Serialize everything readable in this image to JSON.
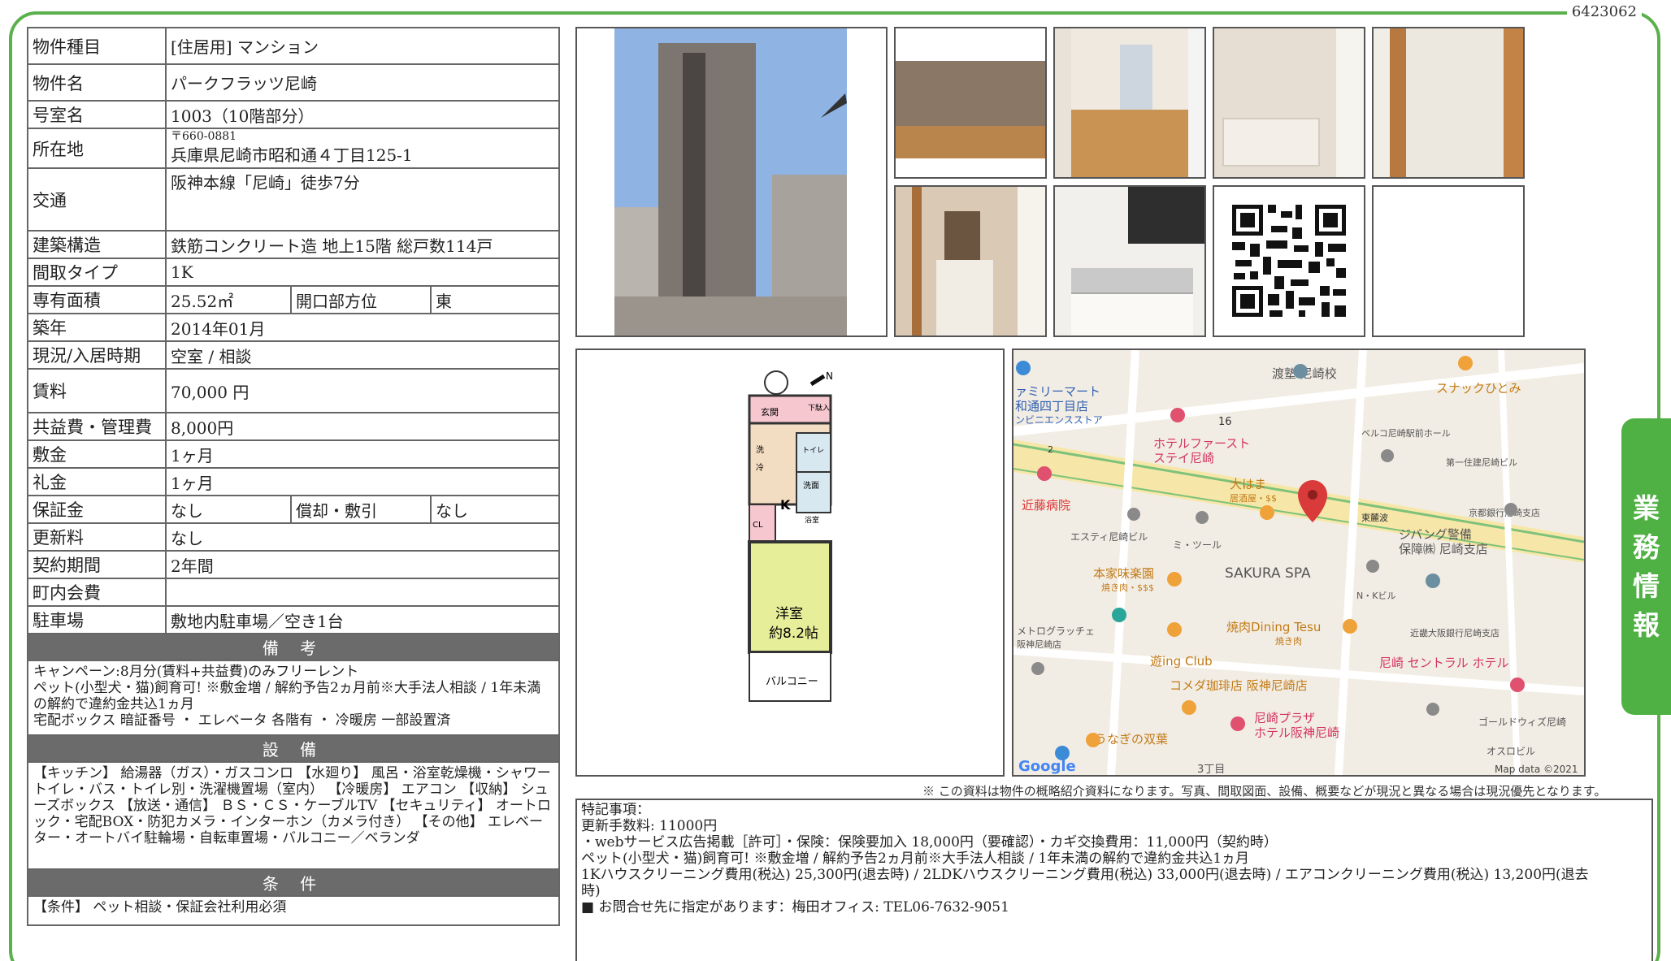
{
  "page": {
    "property_id": "6423062",
    "side_tab": [
      "業",
      "務",
      "情",
      "報"
    ]
  },
  "spec": {
    "type_label": "物件種目",
    "type_value": "[住居用] マンション",
    "name_label": "物件名",
    "name_value": "パークフラッツ尼崎",
    "room_label": "号室名",
    "room_value": "1003（10階部分）",
    "address_label": "所在地",
    "postal": "〒660-0881",
    "address": "兵庫県尼崎市昭和通４丁目125-1",
    "transit_label": "交通",
    "transit_value": "阪神本線「尼崎」徒歩7分",
    "structure_label": "建築構造",
    "structure_value": "鉄筋コンクリート造 地上15階 総戸数114戸",
    "layout_label": "間取タイプ",
    "layout_value": "1K",
    "area_label": "専有面積",
    "area_value": "25.52㎡",
    "direction_label": "開口部方位",
    "direction_value": "東",
    "built_label": "築年",
    "built_value": "2014年01月",
    "status_label": "現況/入居時期",
    "status_value": "空室 / 相談",
    "rent_label": "賃料",
    "rent_value": "70,000 円",
    "fee_label": "共益費・管理費",
    "fee_value": "8,000円",
    "deposit_label": "敷金",
    "deposit_value": "1ヶ月",
    "key_label": "礼金",
    "key_value": "1ヶ月",
    "guarantee_label": "保証金",
    "guarantee_value": "なし",
    "amort_label": "償却・敷引",
    "amort_value": "なし",
    "renew_label": "更新料",
    "renew_value": "なし",
    "contract_label": "契約期間",
    "contract_value": "2年間",
    "assoc_label": "町内会費",
    "assoc_value": "",
    "parking_label": "駐車場",
    "parking_value": "敷地内駐車場／空き1台",
    "remarks_header": "備 考",
    "remarks": "キャンペーン:8月分(賃料+共益費)のみフリーレント\nペット(小型犬・猫)飼育可! ※敷金増 / 解約予告2ヵ月前※大手法人相談 / 1年未満の解約で違約金共込1ヵ月\n宅配ボックス 暗証番号 ・ エレベータ 各階有 ・ 冷暖房 一部設置済",
    "equipment_header": "設 備",
    "equipment": "【キッチン】 給湯器（ガス）・ガスコンロ 【水廻り】 風呂・浴室乾燥機・シャワートイレ・バス・トイレ別・洗濯機置場（室内） 【冷暖房】 エアコン 【収納】 シューズボックス 【放送・通信】 ＢＳ・ＣＳ・ケーブルTV 【セキュリティ】 オートロック・宅配BOX・防犯カメラ・インターホン（カメラ付き） 【その他】 エレベーター・オートバイ駐輪場・自転車置場・バルコニー／ベランダ",
    "conditions_header": "条 件",
    "conditions": "【条件】 ペット相談・保証会社利用必須"
  },
  "floorplan": {
    "entrance": "玄関",
    "shoebox": "下駄入",
    "toilet": "トイレ",
    "laundry": "洗",
    "wash": "洗面",
    "kitchen": "K",
    "bath": "浴室",
    "closet": "CL",
    "room": "洋室",
    "room_size": "約8.2帖",
    "balcony": "バルコニー",
    "refrig": "冷",
    "north": "N"
  },
  "map": {
    "labels": [
      "渡塾 尼崎校",
      "スナックひとみ",
      "ァミリーマート",
      "和通四丁目店",
      "ンビニエンスストア",
      "16",
      "2",
      "ホテルファースト",
      "ステイ尼崎",
      "ベルコ尼崎駅前ホール",
      "第一住建尼崎ビル",
      "近藤病院",
      "大はま",
      "居酒屋・$$",
      "東麓波",
      "京都銀行尼崎支店",
      "エスティ尼崎ビル",
      "ミ・ツール",
      "ジバング警備",
      "保障㈱ 尼崎支店",
      "SAKURA SPA",
      "本家味楽園",
      "焼き肉・$$$",
      "N・Kビル",
      "メトログラッチェ",
      "阪神尼崎店",
      "焼肉Dining Tesu",
      "焼き肉",
      "近畿大阪銀行尼崎支店",
      "遊ing Club",
      "尼崎 セントラル ホテル",
      "コメダ珈琲店 阪神尼崎店",
      "尼崎プラザ",
      "ホテル阪神尼崎",
      "ゴールドウィズ尼崎",
      "うなぎの双葉",
      "オスロビル",
      "3丁目",
      "Google",
      "Map data ©2021"
    ]
  },
  "disclaimer": "※ この資料は物件の概略紹介資料になります。写真、間取図面、設備、概要などが現況と異なる場合は現況優先となります。",
  "notes": [
    "特記事項：",
    "更新手数料: 11000円",
    "・webサービス広告掲載［許可］・保険：保険要加入 18,000円（要確認）・カギ交換費用：11,000円（契約時）",
    "ペット(小型犬・猫)飼育可! ※敷金増 / 解約予告2ヵ月前※大手法人相談 / 1年未満の解約で違約金共込1ヵ月",
    "1Kハウスクリーニング費用(税込) 25,300円(退去時) / 2LDKハウスクリーニング費用(税込) 33,000円(退去時) / エアコンクリーニング費用(税込) 13,200円(退去",
    "時)",
    "■ お問合せ先に指定があります：梅田オフィス: TEL06-7632-9051"
  ],
  "colors": {
    "frame": "#5ab04a",
    "section": "#6b6b6b",
    "map_pin": "#d93a3a"
  }
}
